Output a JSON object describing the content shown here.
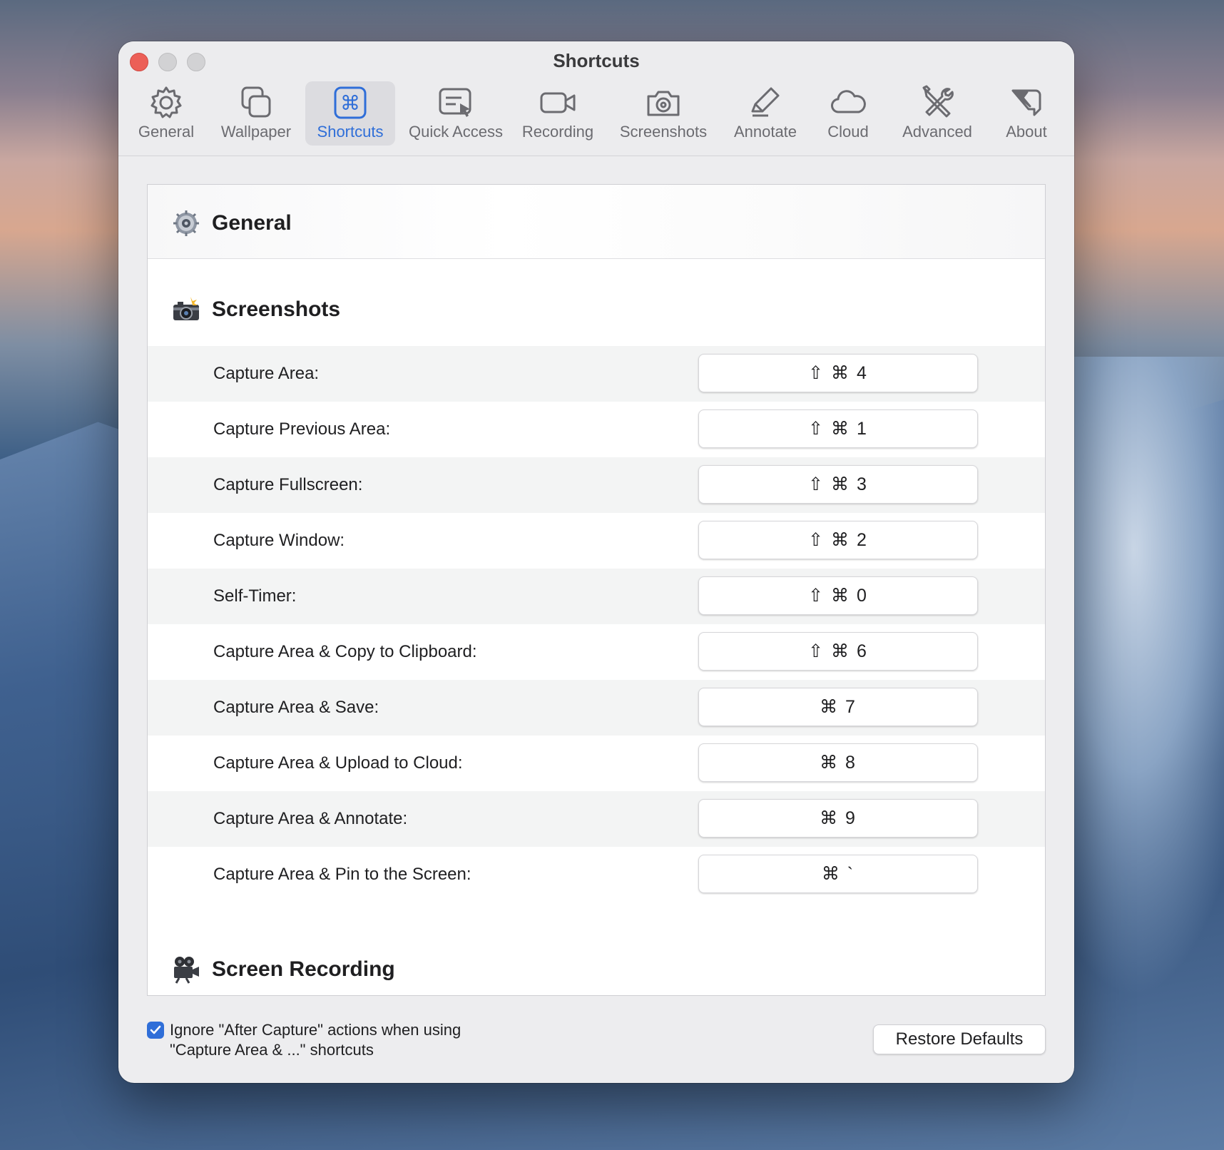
{
  "window": {
    "title": "Shortcuts"
  },
  "toolbar": {
    "tabs": [
      {
        "label": "General",
        "icon": "gear-icon"
      },
      {
        "label": "Wallpaper",
        "icon": "wallpaper-icon"
      },
      {
        "label": "Shortcuts",
        "icon": "command-key-icon",
        "active": true
      },
      {
        "label": "Quick Access",
        "icon": "quick-access-icon"
      },
      {
        "label": "Recording",
        "icon": "video-camera-icon"
      },
      {
        "label": "Screenshots",
        "icon": "camera-icon"
      },
      {
        "label": "Annotate",
        "icon": "highlighter-icon"
      },
      {
        "label": "Cloud",
        "icon": "cloud-icon"
      },
      {
        "label": "Advanced",
        "icon": "tools-icon"
      },
      {
        "label": "About",
        "icon": "about-tag-icon"
      }
    ],
    "accent": "#2f6ed8"
  },
  "sections": {
    "general": {
      "title": "General",
      "icon": "gear-emoji-icon"
    },
    "screenshots": {
      "title": "Screenshots",
      "icon": "camera-flash-emoji-icon"
    },
    "recording": {
      "title": "Screen Recording",
      "icon": "movie-camera-emoji-icon"
    }
  },
  "shortcuts": [
    {
      "label": "Capture Area:",
      "keys": "⇧ ⌘ 4"
    },
    {
      "label": "Capture Previous Area:",
      "keys": "⇧ ⌘ 1"
    },
    {
      "label": "Capture Fullscreen:",
      "keys": "⇧ ⌘ 3"
    },
    {
      "label": "Capture Window:",
      "keys": "⇧ ⌘ 2"
    },
    {
      "label": "Self-Timer:",
      "keys": "⇧ ⌘ 0"
    },
    {
      "label": "Capture Area & Copy to Clipboard:",
      "keys": "⇧ ⌘ 6"
    },
    {
      "label": "Capture Area & Save:",
      "keys": "⌘ 7"
    },
    {
      "label": "Capture Area & Upload to Cloud:",
      "keys": "⌘ 8"
    },
    {
      "label": "Capture Area & Annotate:",
      "keys": "⌘ 9"
    },
    {
      "label": "Capture Area & Pin to the Screen:",
      "keys": "⌘ `"
    }
  ],
  "footer": {
    "checkbox_label": "Ignore \"After Capture\" actions when using \"Capture Area & ...\" shortcuts",
    "checkbox_checked": true,
    "restore_label": "Restore Defaults"
  }
}
